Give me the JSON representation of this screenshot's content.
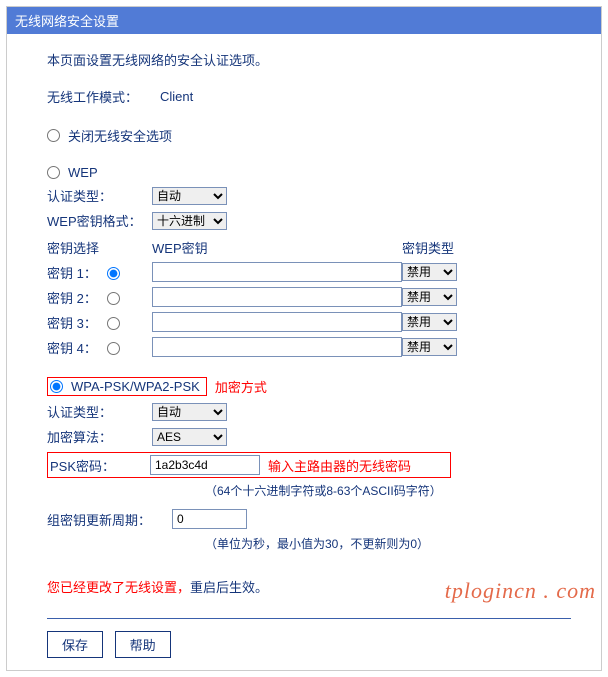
{
  "title": "无线网络安全设置",
  "intro": "本页面设置无线网络的安全认证选项。",
  "mode_label": "无线工作模式：",
  "mode_value": "Client",
  "opt_disable": "关闭无线安全选项",
  "opt_wep": "WEP",
  "auth_label": "认证类型：",
  "auth_value": "自动",
  "wepfmt_label": "WEP密钥格式：",
  "wepfmt_value": "十六进制",
  "keysel_label": "密钥选择",
  "wepkey_label": "WEP密钥",
  "keytype_label": "密钥类型",
  "keys": [
    {
      "label": "密钥 1：",
      "type": "禁用"
    },
    {
      "label": "密钥 2：",
      "type": "禁用"
    },
    {
      "label": "密钥 3：",
      "type": "禁用"
    },
    {
      "label": "密钥 4：",
      "type": "禁用"
    }
  ],
  "opt_wpa": "WPA-PSK/WPA2-PSK",
  "enc_method_title": "加密方式",
  "auth2_value": "自动",
  "algo_label": "加密算法：",
  "algo_value": "AES",
  "psk_label": "PSK密码：",
  "psk_value": "1a2b3c4d",
  "psk_hint": "输入主路由器的无线密码",
  "psk_note": "（64个十六进制字符或8-63个ASCII码字符）",
  "rekey_label": "组密钥更新周期：",
  "rekey_value": "0",
  "rekey_note": "（单位为秒，最小值为30，不更新则为0）",
  "changed_msg": "您已经更改了无线设置，",
  "changed_tail": "重启后生效。",
  "btn_save": "保存",
  "btn_help": "帮助",
  "watermark_a": "tplogincn",
  "watermark_b": "com"
}
